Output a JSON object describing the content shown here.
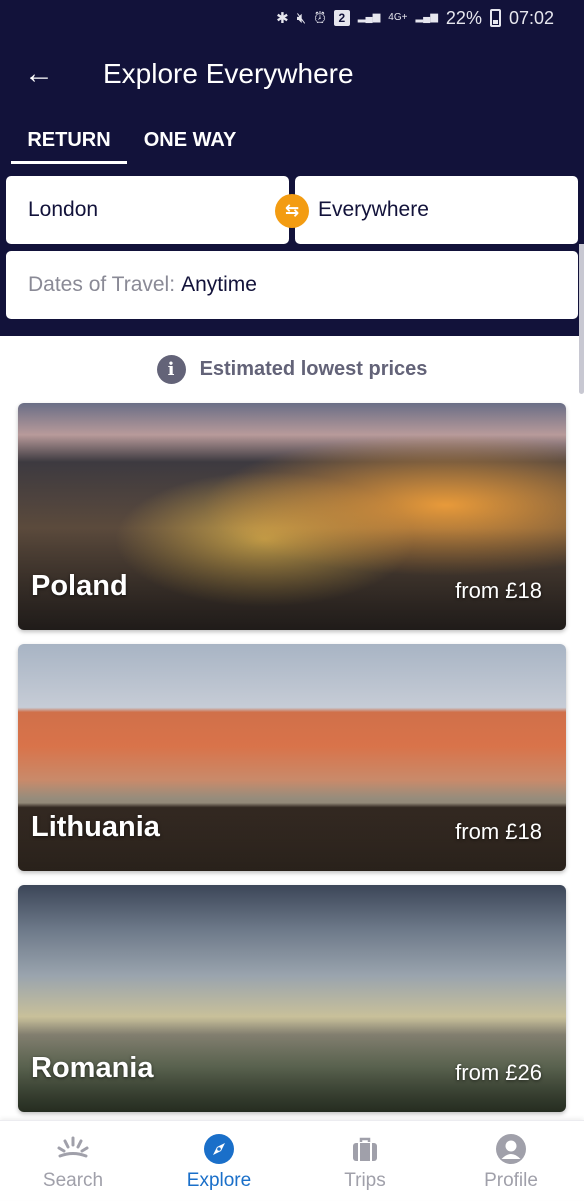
{
  "status_bar": {
    "icons": [
      "bluetooth-icon",
      "mute-icon",
      "alarm-icon",
      "sim-2-icon",
      "signal-roaming-icon",
      "4g-plus-icon",
      "signal-icon"
    ],
    "sim_label": "2",
    "network_label": "4G+",
    "battery_percent": "22%",
    "time": "07:02"
  },
  "header": {
    "back_icon": "←",
    "title": "Explore Everywhere"
  },
  "tabs": [
    {
      "label": "RETURN",
      "active": true
    },
    {
      "label": "ONE WAY",
      "active": false
    }
  ],
  "search": {
    "origin": "London",
    "destination": "Everywhere",
    "swap_icon": "⇆",
    "dates_label": "Dates of Travel:",
    "dates_value": "Anytime"
  },
  "notice": {
    "icon": "i",
    "text": "Estimated lowest prices"
  },
  "destinations": [
    {
      "name": "Poland",
      "price": "from £18"
    },
    {
      "name": "Lithuania",
      "price": "from £18"
    },
    {
      "name": "Romania",
      "price": "from £26"
    }
  ],
  "bottom_nav": [
    {
      "label": "Search",
      "icon": "sunrise-icon",
      "active": false
    },
    {
      "label": "Explore",
      "icon": "compass-icon",
      "active": true
    },
    {
      "label": "Trips",
      "icon": "suitcase-icon",
      "active": false
    },
    {
      "label": "Profile",
      "icon": "profile-icon",
      "active": false
    }
  ],
  "colors": {
    "header_bg": "#12123a",
    "accent_orange": "#f39c12",
    "active_blue": "#1a6fc9",
    "inactive_gray": "#a0a0aa"
  }
}
